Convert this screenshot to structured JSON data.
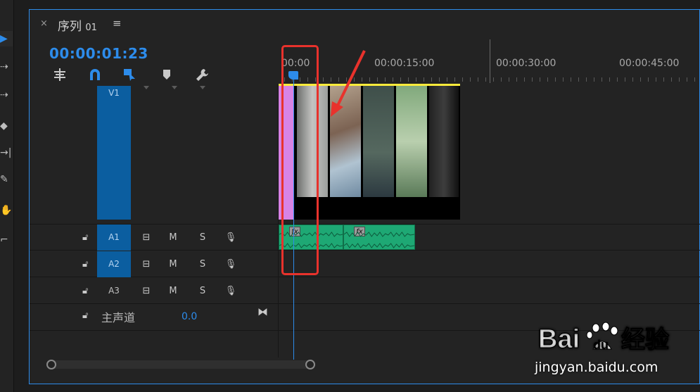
{
  "toolbar": {
    "tools": [
      "selection-tool",
      "track-select-forward-tool",
      "track-select-backward-tool",
      "ripple-edit-tool",
      "razor-tool",
      "pen-tool",
      "hand-tool",
      "type-tool"
    ]
  },
  "tab": {
    "close": "×",
    "title": "序列",
    "number": "01",
    "menu": "≡"
  },
  "timecode": "00:00:01:23",
  "ruler": {
    "labels": [
      "00:00",
      "00:00:15:00",
      "00:00:30:00",
      "00:00:45:00"
    ]
  },
  "tracks": {
    "video": [
      {
        "name": "V1"
      }
    ],
    "audio": [
      {
        "name": "A1",
        "selected": true,
        "mute": "M",
        "solo": "S"
      },
      {
        "name": "A2",
        "selected": true,
        "mute": "M",
        "solo": "S"
      },
      {
        "name": "A3",
        "selected": false,
        "mute": "M",
        "solo": "S"
      }
    ],
    "master": {
      "label": "主声道",
      "value": "0.0"
    }
  },
  "clips": {
    "fx_label": "fx"
  },
  "watermark": {
    "logo": "Bai du 经验",
    "url": "jingyan.baidu.com"
  },
  "colors": {
    "accent": "#2d8ceb",
    "track_selected": "#0b5ea0",
    "audio_clip": "#1ea874",
    "video_strip": "#d783e5",
    "work_area": "#ffeb3b",
    "annotation": "#e8322c"
  }
}
